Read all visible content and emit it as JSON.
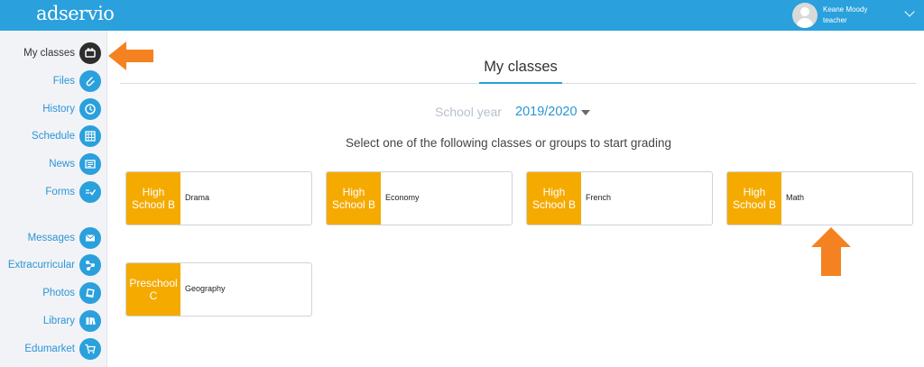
{
  "app": {
    "logo": "adservio"
  },
  "user": {
    "name": "Keane Moody",
    "role": "teacher"
  },
  "sidebar": {
    "items": [
      {
        "label": "My classes",
        "icon": "classes-icon",
        "active": true
      },
      {
        "label": "Files",
        "icon": "paperclip-icon"
      },
      {
        "label": "History",
        "icon": "history-icon"
      },
      {
        "label": "Schedule",
        "icon": "calendar-icon"
      },
      {
        "label": "News",
        "icon": "news-icon"
      },
      {
        "label": "Forms",
        "icon": "forms-icon"
      },
      {
        "label": "Messages",
        "icon": "envelope-icon"
      },
      {
        "label": "Extracurricular",
        "icon": "extracurricular-icon"
      },
      {
        "label": "Photos",
        "icon": "photos-icon"
      },
      {
        "label": "Library",
        "icon": "library-icon"
      },
      {
        "label": "Edumarket",
        "icon": "cart-icon"
      }
    ]
  },
  "main": {
    "title": "My classes",
    "school_year_label": "School year",
    "school_year_value": "2019/2020",
    "instruction": "Select one of the following classes or groups to start grading",
    "classes": [
      {
        "level": "High School B",
        "subject": "Drama"
      },
      {
        "level": "High School B",
        "subject": "Economy"
      },
      {
        "level": "High School B",
        "subject": "French"
      },
      {
        "level": "High School B",
        "subject": "Math"
      },
      {
        "level": "Preschool C",
        "subject": "Geography"
      }
    ]
  },
  "colors": {
    "topbar": "#2aa0dc",
    "accent": "#2aa0dc",
    "class_level": "#f5aa00",
    "annotation_arrow": "#f58220",
    "active_icon": "#2d2d2d"
  }
}
